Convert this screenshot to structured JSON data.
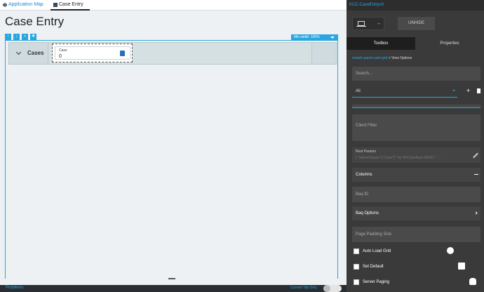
{
  "tabs": [
    {
      "label": "Application Map",
      "icon": "application-map-icon"
    },
    {
      "label": "Case Entry",
      "icon": "layout-icon"
    }
  ],
  "page_title": "Case Entry",
  "toolbar_icons": [
    "arrow-up-icon",
    "arrow-down-icon",
    "delete-icon",
    "move-icon"
  ],
  "min_width": "Min width: 100%",
  "panel": {
    "title": "Cases",
    "card": {
      "label": "Case",
      "value": "0"
    }
  },
  "bottom_bar": {
    "problems": "Problems",
    "current_tab_only": "Current Tab Only"
  },
  "right_panel": {
    "app_name": "KCC-CaseEntryv3",
    "unhide": "UNHIDE",
    "tabs": [
      "Toolbox",
      "Properties"
    ],
    "breadcrumb": {
      "link": "metafx-panel-card-grid",
      "sep": " > ",
      "current": "View Options"
    },
    "search_placeholder": "Search...",
    "filter_value": "All",
    "client_filter_placeholder": "Client Filter",
    "rest_params": {
      "label": "Rest Params",
      "value": "{ \"whereClause\":[\"Case\"]\":\"by HDCaseNum DESC\", \"..."
    },
    "sections": {
      "columns": "Columns",
      "baq_id": "Baq ID",
      "baq_options": "Baq Options",
      "page_padding": "Page Padding Size"
    },
    "checkboxes": [
      {
        "label": "Auto Load Grid",
        "checked": false
      },
      {
        "label": "Set Default",
        "checked": false
      },
      {
        "label": "Server Paging",
        "checked": false
      }
    ]
  }
}
